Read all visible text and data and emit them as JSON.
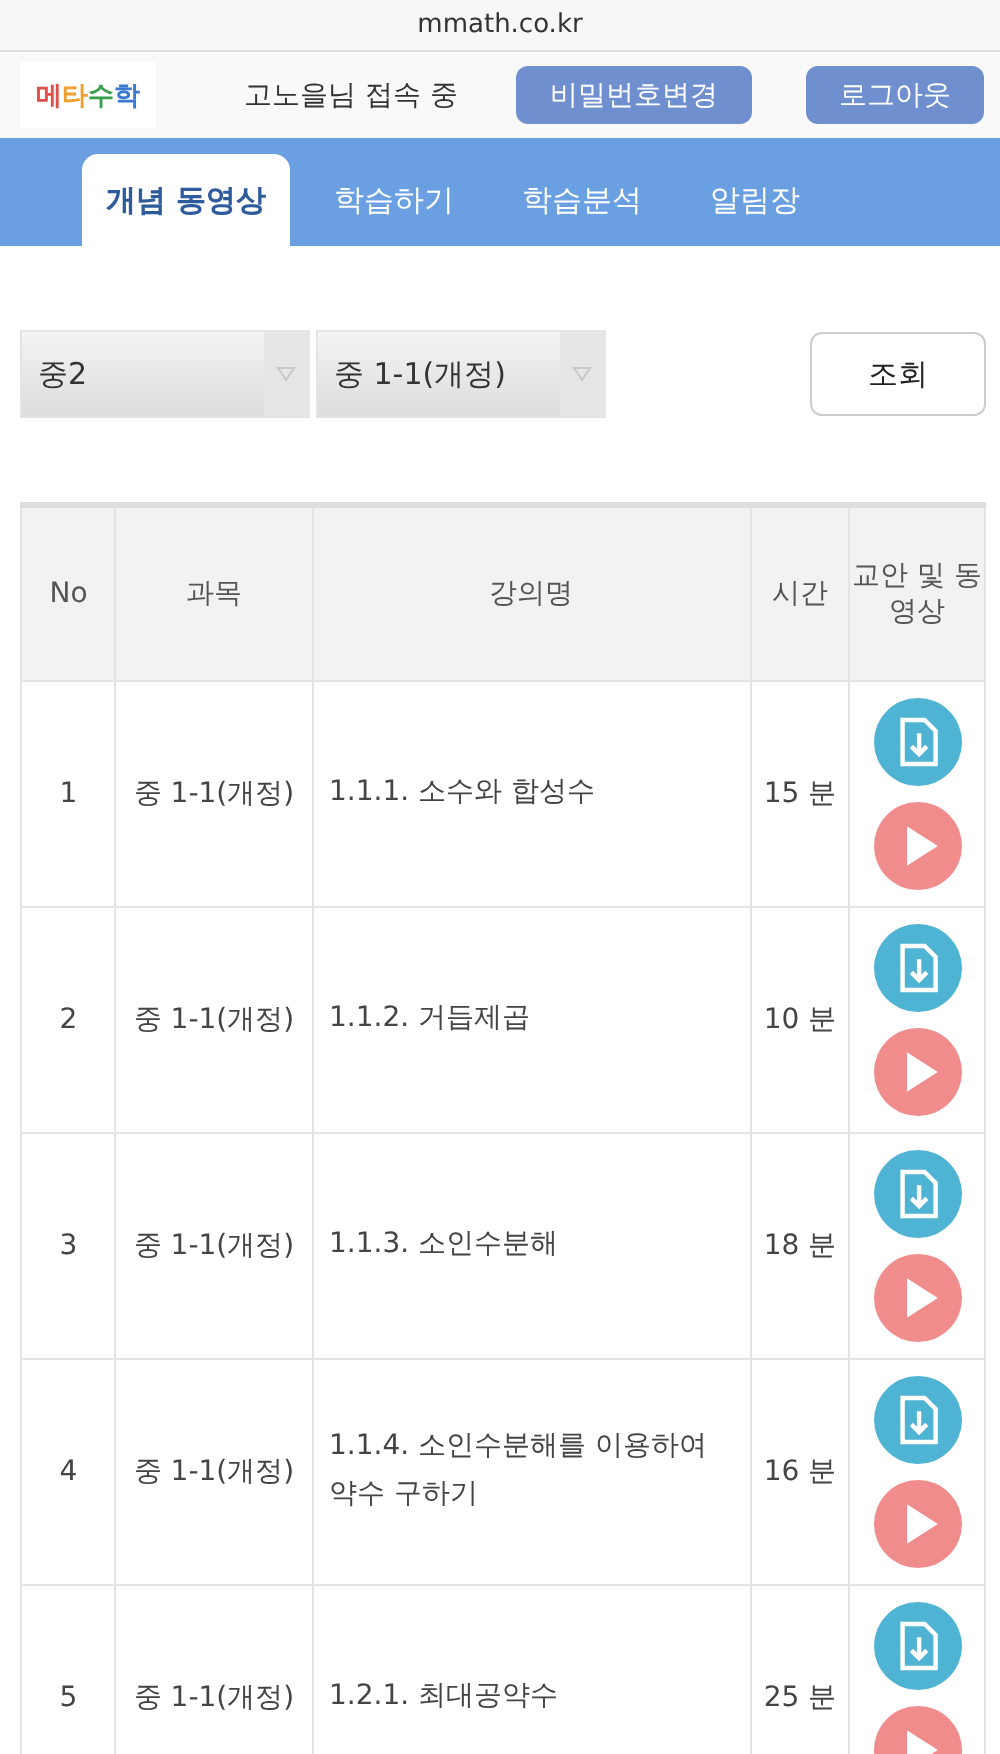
{
  "browser": {
    "url": "mmath.co.kr"
  },
  "header": {
    "logo": "메타수학",
    "greeting": "고노을님 접속 중",
    "buttons": [
      "비밀번호변경",
      "로그아웃"
    ]
  },
  "tabs": [
    {
      "label": "개념 동영상",
      "selected": true
    },
    {
      "label": "학습하기",
      "selected": false
    },
    {
      "label": "학습분석",
      "selected": false
    },
    {
      "label": "알림장",
      "selected": false
    }
  ],
  "filters": {
    "selects": [
      "중2",
      "중 1-1(개정)"
    ],
    "search_button": "조회"
  },
  "table": {
    "columns": [
      "No",
      "과목",
      "강의명",
      "시간",
      "교안 및 동영상"
    ],
    "rows": [
      {
        "no": "1",
        "subject": "중 1-1(개정)",
        "title": "1.1.1. 소수와 합성수",
        "time": "15 분"
      },
      {
        "no": "2",
        "subject": "중 1-1(개정)",
        "title": "1.1.2. 거듭제곱",
        "time": "10 분"
      },
      {
        "no": "3",
        "subject": "중 1-1(개정)",
        "title": "1.1.3. 소인수분해",
        "time": "18 분"
      },
      {
        "no": "4",
        "subject": "중 1-1(개정)",
        "title": "1.1.4. 소인수분해를 이용하여 약수 구하기",
        "time": "16 분"
      },
      {
        "no": "5",
        "subject": "중 1-1(개정)",
        "title": "1.2.1. 최대공약수",
        "time": "25 분"
      }
    ]
  }
}
